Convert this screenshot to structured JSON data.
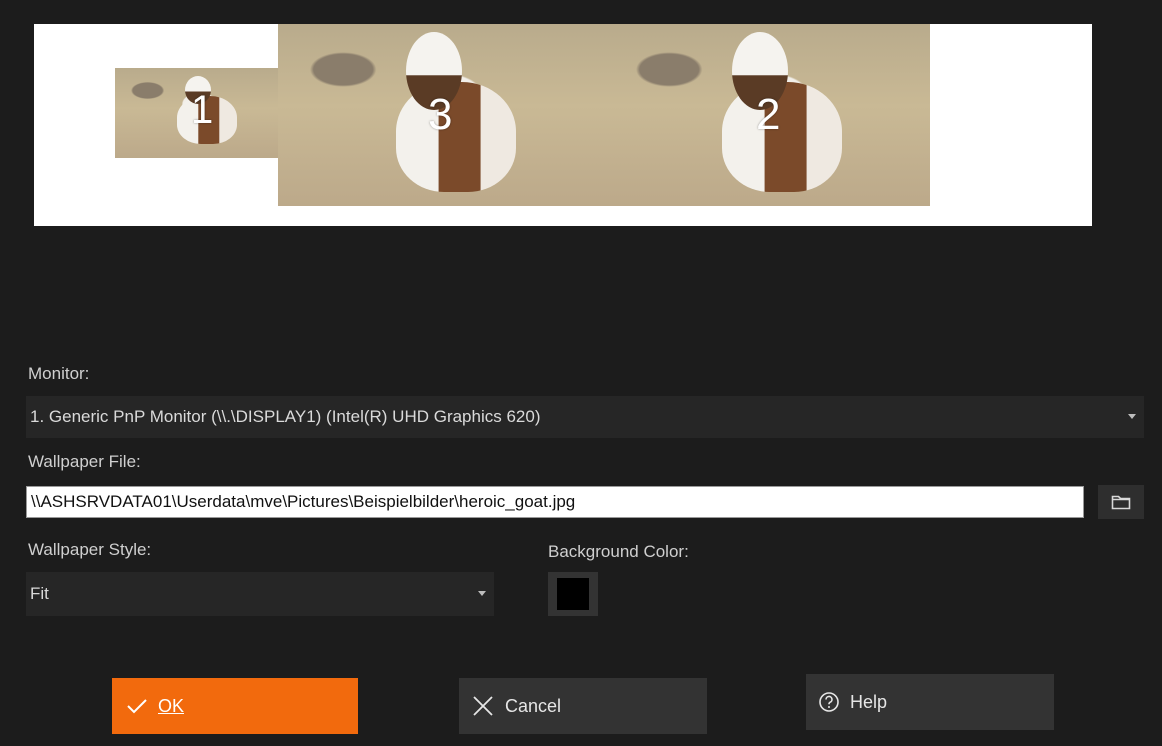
{
  "preview": {
    "monitors": [
      {
        "number": "1"
      },
      {
        "number": "3"
      },
      {
        "number": "2"
      }
    ]
  },
  "monitor": {
    "label": "Monitor:",
    "selected": "1. Generic PnP Monitor (\\\\.\\DISPLAY1) (Intel(R) UHD Graphics 620)"
  },
  "wallpaper_file": {
    "label": "Wallpaper File:",
    "value": "\\\\ASHSRVDATA01\\Userdata\\mve\\Pictures\\Beispielbilder\\heroic_goat.jpg"
  },
  "wallpaper_style": {
    "label": "Wallpaper Style:",
    "selected": "Fit"
  },
  "background_color": {
    "label": "Background Color:",
    "value": "#000000"
  },
  "buttons": {
    "ok": "OK",
    "cancel": "Cancel",
    "help": "Help"
  },
  "colors": {
    "accent": "#f26a0d",
    "background": "#1c1c1c"
  },
  "icons": {
    "ok": "checkmark-icon",
    "cancel": "x-icon",
    "help": "question-circle-icon",
    "browse": "folder-icon"
  }
}
